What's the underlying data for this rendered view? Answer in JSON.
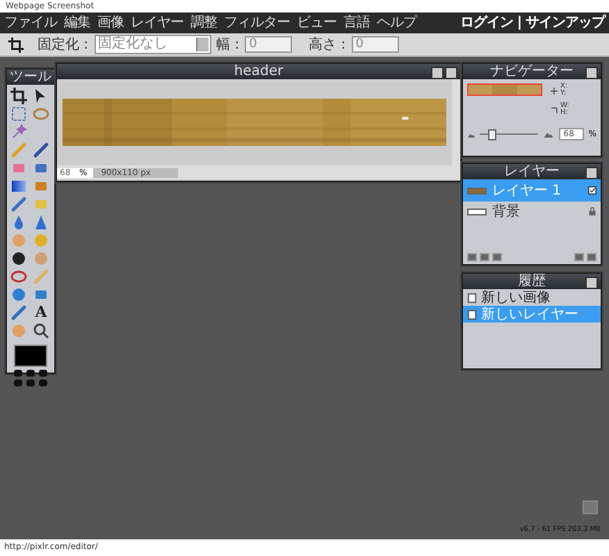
{
  "caption": "Webpage Screenshot",
  "menu": {
    "items": [
      "ファイル",
      "編集",
      "画像",
      "レイヤー",
      "調整",
      "フィルター",
      "ビュー",
      "言語",
      "ヘルプ"
    ],
    "login": "ログイン",
    "separator": "|",
    "signup": "サインアップ"
  },
  "toolbar": {
    "fix_label": "固定化 :",
    "fix_value": "固定化なし",
    "width_label": "幅 :",
    "width_value": "0",
    "height_label": "高さ :",
    "height_value": "0"
  },
  "tools": {
    "title": "ツール",
    "text_tool": "A"
  },
  "image_window": {
    "title": "header",
    "zoom": "68",
    "percent": "%",
    "size": "900x110 px"
  },
  "navigator": {
    "title": "ナビゲーター",
    "x": "X:",
    "y": "Y:",
    "w": "W:",
    "h": "H:",
    "level": 0.2,
    "zoom": "68",
    "percent": "%"
  },
  "layers": {
    "title": "レイヤー",
    "items": [
      {
        "name": "レイヤー 1",
        "selected": true,
        "locked": false
      },
      {
        "name": "背景",
        "kind": "blank",
        "selected": false,
        "locked": true
      }
    ]
  },
  "history": {
    "title": "履歴",
    "items": [
      {
        "label": "新しい画像",
        "selected": false
      },
      {
        "label": "新しいレイヤー",
        "selected": true
      }
    ]
  },
  "version": "v6.7 - 61 FPS 203.3 MB",
  "status_url": "http://pixlr.com/editor/"
}
